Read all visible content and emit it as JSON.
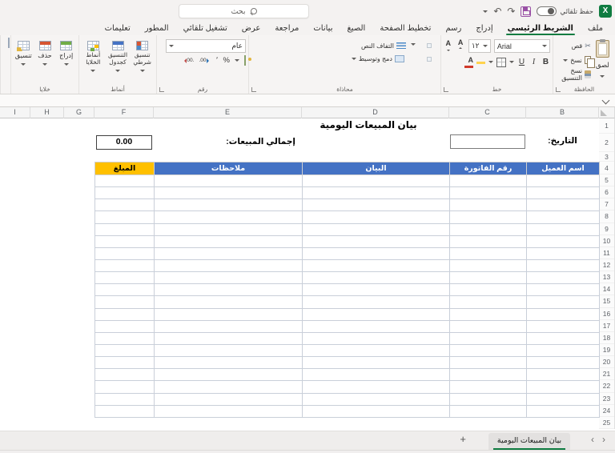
{
  "titlebar": {
    "app_logo_letter": "X",
    "autosave_label": "حفظ تلقائي",
    "search_placeholder": "بحث"
  },
  "icons": {
    "scissors": "✂",
    "undo": "↶",
    "redo": "↷"
  },
  "ribbon_tabs": [
    "ملف",
    "الشريط الرئيسي",
    "إدراج",
    "رسم",
    "تخطيط الصفحة",
    "الصيغ",
    "بيانات",
    "مراجعة",
    "عرض",
    "تشغيل تلقائي",
    "المطور",
    "تعليمات"
  ],
  "active_tab": "الشريط الرئيسي",
  "ribbon": {
    "clipboard": {
      "label": "الحافظة",
      "paste": "لصق",
      "cut": "قص",
      "copy": "نسخ",
      "format_painter": "نسخ التنسيق"
    },
    "font": {
      "label": "خط",
      "font_name": "Arial",
      "font_size": "١٢",
      "bold": "B",
      "italic": "I",
      "underline": "U",
      "letter": "A"
    },
    "alignment": {
      "label": "محاذاة",
      "wrap_text": "التفاف النص",
      "merge_center": "دمج وتوسيط"
    },
    "number": {
      "label": "رقم",
      "format": "عام",
      "percent": "%",
      "comma": "٬",
      "decimal_increase": "00.",
      "decimal_decrease": ".00"
    },
    "styles": {
      "label": "أنماط",
      "conditional": "تنسيق شرطي",
      "format_table": "التنسيق كجدول",
      "cell_styles": "أنماط الخلايا"
    },
    "cells": {
      "label": "خلايا",
      "insert": "إدراج",
      "delete": "حذف",
      "format": "تنسيق"
    }
  },
  "grid": {
    "columns": [
      "I",
      "H",
      "G",
      "F",
      "E",
      "D",
      "C",
      "B"
    ],
    "rows": [
      1,
      2,
      3,
      4,
      5,
      6,
      7,
      8,
      9,
      10,
      11,
      12,
      13,
      14,
      15,
      16,
      17,
      18,
      19,
      20,
      21,
      22,
      23,
      24,
      25
    ]
  },
  "sheet": {
    "title": "بيان المبيعات اليومية",
    "date_label": "التاريخ:",
    "date_value": "",
    "total_label": "إجمالي المبيعات:",
    "total_value": "0.00",
    "table": {
      "headers": [
        {
          "label": "المبلغ",
          "bg": "#FFC000",
          "fg": "#000000"
        },
        {
          "label": "ملاحظات",
          "bg": "#4472C4",
          "fg": "#FFFFFF"
        },
        {
          "label": "البيان",
          "bg": "#4472C4",
          "fg": "#FFFFFF"
        },
        {
          "label": "رقم الفاتورة",
          "bg": "#4472C4",
          "fg": "#FFFFFF"
        },
        {
          "label": "اسم العميل",
          "bg": "#4472C4",
          "fg": "#FFFFFF"
        }
      ],
      "empty_rows": 20
    }
  },
  "sheet_tabs": {
    "active": "بيان المبيعات اليومية",
    "add_button": "+",
    "prev": "‹",
    "next": "›"
  },
  "colors": {
    "accent_green": "#107C41",
    "header_blue": "#4472C4",
    "header_yellow": "#FFC000",
    "save_purple": "#9950A5"
  }
}
